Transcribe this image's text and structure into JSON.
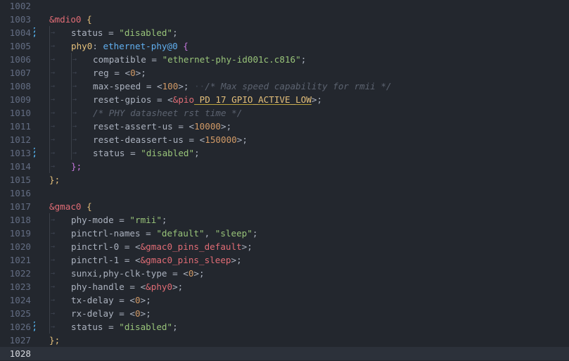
{
  "editor": {
    "language": "devicetree",
    "current_line": "1028",
    "lines": [
      {
        "num": "1002",
        "indent": 0,
        "tokens": []
      },
      {
        "num": "1003",
        "indent": 0,
        "tokens": [
          {
            "t": "&mdio0",
            "c": "c-label"
          },
          {
            "t": " ",
            "c": "c-punct"
          },
          {
            "t": "{",
            "c": "c-brace"
          }
        ]
      },
      {
        "num": "1004",
        "indent": 1,
        "mod": true,
        "tokens": [
          {
            "t": "status",
            "c": "c-prop"
          },
          {
            "t": " = ",
            "c": "c-punct"
          },
          {
            "t": "\"disabled\"",
            "c": "c-str"
          },
          {
            "t": ";",
            "c": "c-punct"
          }
        ]
      },
      {
        "num": "1005",
        "indent": 1,
        "tokens": [
          {
            "t": "phy0",
            "c": "c-node"
          },
          {
            "t": ": ",
            "c": "c-punct"
          },
          {
            "t": "ethernet-phy@0",
            "c": "c-nodename"
          },
          {
            "t": " ",
            "c": "c-punct"
          },
          {
            "t": "{",
            "c": "c-brace2"
          }
        ]
      },
      {
        "num": "1006",
        "indent": 2,
        "tokens": [
          {
            "t": "compatible",
            "c": "c-prop"
          },
          {
            "t": " = ",
            "c": "c-punct"
          },
          {
            "t": "\"ethernet-phy-id001c.c816\"",
            "c": "c-str"
          },
          {
            "t": ";",
            "c": "c-punct"
          }
        ]
      },
      {
        "num": "1007",
        "indent": 2,
        "tokens": [
          {
            "t": "reg",
            "c": "c-prop"
          },
          {
            "t": " = ",
            "c": "c-punct"
          },
          {
            "t": "<",
            "c": "c-punct"
          },
          {
            "t": "0",
            "c": "c-num"
          },
          {
            "t": ">;",
            "c": "c-punct"
          }
        ]
      },
      {
        "num": "1008",
        "indent": 2,
        "tokens": [
          {
            "t": "max-speed",
            "c": "c-prop"
          },
          {
            "t": " = ",
            "c": "c-punct"
          },
          {
            "t": "<",
            "c": "c-punct"
          },
          {
            "t": "100",
            "c": "c-num"
          },
          {
            "t": ">;",
            "c": "c-punct"
          },
          {
            "t": " ··",
            "c": "c-dots"
          },
          {
            "t": "/* Max speed capability for rmii */",
            "c": "c-comment"
          }
        ]
      },
      {
        "num": "1009",
        "indent": 2,
        "tokens": [
          {
            "t": "reset-gpios",
            "c": "c-prop"
          },
          {
            "t": " = ",
            "c": "c-punct"
          },
          {
            "t": "<",
            "c": "c-punct"
          },
          {
            "t": "&pio",
            "c": "c-ref"
          },
          {
            "t": " PD 17 GPIO_ACTIVE_LOW",
            "c": "c-brace",
            "ul": true
          },
          {
            "t": ">;",
            "c": "c-punct"
          }
        ]
      },
      {
        "num": "1010",
        "indent": 2,
        "tokens": [
          {
            "t": "/* PHY datasheet rst time */",
            "c": "c-comment"
          }
        ]
      },
      {
        "num": "1011",
        "indent": 2,
        "tokens": [
          {
            "t": "reset-assert-us",
            "c": "c-prop"
          },
          {
            "t": " = ",
            "c": "c-punct"
          },
          {
            "t": "<",
            "c": "c-punct"
          },
          {
            "t": "10000",
            "c": "c-num"
          },
          {
            "t": ">;",
            "c": "c-punct"
          }
        ]
      },
      {
        "num": "1012",
        "indent": 2,
        "tokens": [
          {
            "t": "reset-deassert-us",
            "c": "c-prop"
          },
          {
            "t": " = ",
            "c": "c-punct"
          },
          {
            "t": "<",
            "c": "c-punct"
          },
          {
            "t": "150000",
            "c": "c-num"
          },
          {
            "t": ">;",
            "c": "c-punct"
          }
        ]
      },
      {
        "num": "1013",
        "indent": 2,
        "mod": true,
        "tokens": [
          {
            "t": "status",
            "c": "c-prop"
          },
          {
            "t": " = ",
            "c": "c-punct"
          },
          {
            "t": "\"disabled\"",
            "c": "c-str"
          },
          {
            "t": ";",
            "c": "c-punct"
          }
        ]
      },
      {
        "num": "1014",
        "indent": 1,
        "tokens": [
          {
            "t": "};",
            "c": "c-brace2"
          }
        ]
      },
      {
        "num": "1015",
        "indent": 0,
        "tokens": [
          {
            "t": "};",
            "c": "c-brace"
          }
        ]
      },
      {
        "num": "1016",
        "indent": 0,
        "tokens": []
      },
      {
        "num": "1017",
        "indent": 0,
        "tokens": [
          {
            "t": "&gmac0",
            "c": "c-label"
          },
          {
            "t": " ",
            "c": "c-punct"
          },
          {
            "t": "{",
            "c": "c-brace"
          }
        ]
      },
      {
        "num": "1018",
        "indent": 1,
        "tokens": [
          {
            "t": "phy-mode",
            "c": "c-prop"
          },
          {
            "t": " = ",
            "c": "c-punct"
          },
          {
            "t": "\"rmii\"",
            "c": "c-str"
          },
          {
            "t": ";",
            "c": "c-punct"
          }
        ]
      },
      {
        "num": "1019",
        "indent": 1,
        "tokens": [
          {
            "t": "pinctrl-names",
            "c": "c-prop"
          },
          {
            "t": " = ",
            "c": "c-punct"
          },
          {
            "t": "\"default\"",
            "c": "c-str"
          },
          {
            "t": ", ",
            "c": "c-punct"
          },
          {
            "t": "\"sleep\"",
            "c": "c-str"
          },
          {
            "t": ";",
            "c": "c-punct"
          }
        ]
      },
      {
        "num": "1020",
        "indent": 1,
        "tokens": [
          {
            "t": "pinctrl-0",
            "c": "c-prop"
          },
          {
            "t": " = ",
            "c": "c-punct"
          },
          {
            "t": "<",
            "c": "c-punct"
          },
          {
            "t": "&gmac0_pins_default",
            "c": "c-ref"
          },
          {
            "t": ">;",
            "c": "c-punct"
          }
        ]
      },
      {
        "num": "1021",
        "indent": 1,
        "tokens": [
          {
            "t": "pinctrl-1",
            "c": "c-prop"
          },
          {
            "t": " = ",
            "c": "c-punct"
          },
          {
            "t": "<",
            "c": "c-punct"
          },
          {
            "t": "&gmac0_pins_sleep",
            "c": "c-ref"
          },
          {
            "t": ">;",
            "c": "c-punct"
          }
        ]
      },
      {
        "num": "1022",
        "indent": 1,
        "tokens": [
          {
            "t": "sunxi,phy-clk-type",
            "c": "c-prop"
          },
          {
            "t": " = ",
            "c": "c-punct"
          },
          {
            "t": "<",
            "c": "c-punct"
          },
          {
            "t": "0",
            "c": "c-num"
          },
          {
            "t": ">;",
            "c": "c-punct"
          }
        ]
      },
      {
        "num": "1023",
        "indent": 1,
        "tokens": [
          {
            "t": "phy-handle",
            "c": "c-prop"
          },
          {
            "t": " = ",
            "c": "c-punct"
          },
          {
            "t": "<",
            "c": "c-punct"
          },
          {
            "t": "&phy0",
            "c": "c-ref"
          },
          {
            "t": ">;",
            "c": "c-punct"
          }
        ]
      },
      {
        "num": "1024",
        "indent": 1,
        "tokens": [
          {
            "t": "tx-delay",
            "c": "c-prop"
          },
          {
            "t": " = ",
            "c": "c-punct"
          },
          {
            "t": "<",
            "c": "c-punct"
          },
          {
            "t": "0",
            "c": "c-num"
          },
          {
            "t": ">;",
            "c": "c-punct"
          }
        ]
      },
      {
        "num": "1025",
        "indent": 1,
        "tokens": [
          {
            "t": "rx-delay",
            "c": "c-prop"
          },
          {
            "t": " = ",
            "c": "c-punct"
          },
          {
            "t": "<",
            "c": "c-punct"
          },
          {
            "t": "0",
            "c": "c-num"
          },
          {
            "t": ">;",
            "c": "c-punct"
          }
        ]
      },
      {
        "num": "1026",
        "indent": 1,
        "mod": true,
        "tokens": [
          {
            "t": "status",
            "c": "c-prop"
          },
          {
            "t": " = ",
            "c": "c-punct"
          },
          {
            "t": "\"disabled\"",
            "c": "c-str"
          },
          {
            "t": ";",
            "c": "c-punct"
          }
        ]
      },
      {
        "num": "1027",
        "indent": 0,
        "tokens": [
          {
            "t": "};",
            "c": "c-brace"
          }
        ]
      },
      {
        "num": "1028",
        "indent": 0,
        "tokens": []
      }
    ]
  }
}
